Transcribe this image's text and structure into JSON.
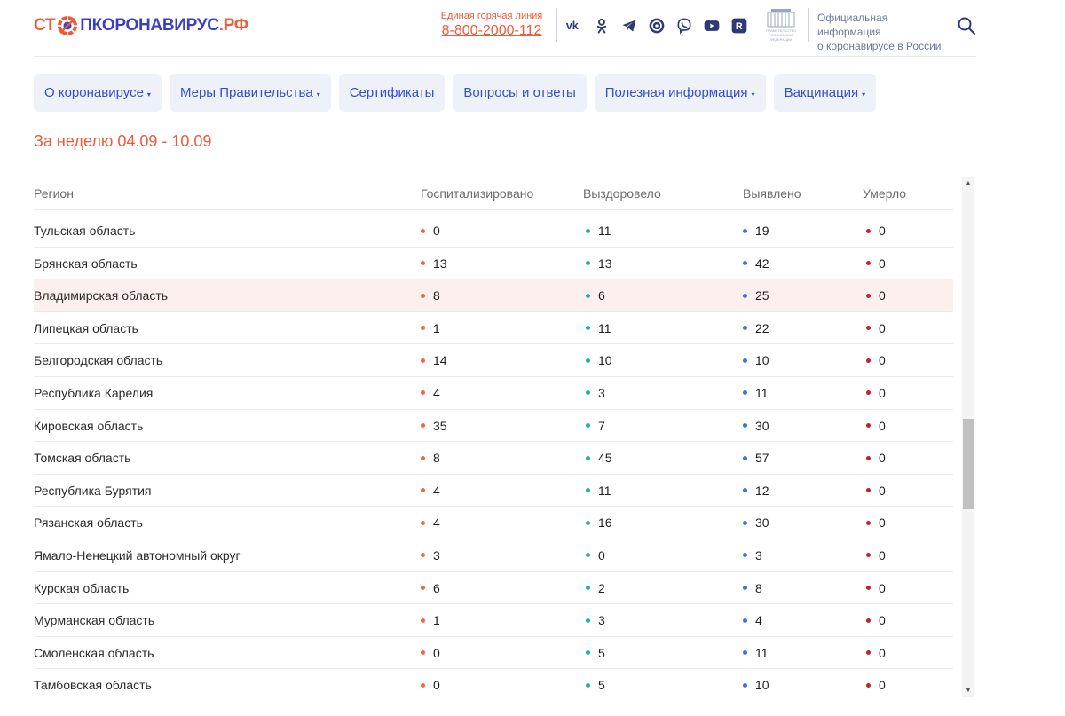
{
  "logo": {
    "part1": "СТ",
    "part2": "ПКОРОНАВИРУС",
    "part3": ".РФ"
  },
  "hotline": {
    "label": "Единая горячая линия",
    "phone": "8-800-2000-112"
  },
  "socials": [
    "vk-icon",
    "ok-icon",
    "telegram-icon",
    "tiktok-icon",
    "viber-icon",
    "youtube-icon",
    "rutube-icon"
  ],
  "gov": {
    "emblem_text": "ПРАВИТЕЛЬСТВО РОССИЙСКОЙ ФЕДЕРАЦИИ",
    "line1": "Официальная информация",
    "line2": "о коронавирусе в России"
  },
  "nav": [
    {
      "label": "О коронавирусе",
      "dropdown": "▾"
    },
    {
      "label": "Меры Правительства",
      "dropdown": "▾"
    },
    {
      "label": "Сертификаты",
      "dropdown": ""
    },
    {
      "label": "Вопросы и ответы",
      "dropdown": ""
    },
    {
      "label": "Полезная информация",
      "dropdown": "▾"
    },
    {
      "label": "Вакцинация",
      "dropdown": "▾"
    }
  ],
  "week_title": "За неделю 04.09 - 10.09",
  "table": {
    "headers": {
      "region": "Регион",
      "hospitalized": "Госпитализировано",
      "recovered": "Выздоровело",
      "detected": "Выявлено",
      "died": "Умерло"
    },
    "rows": [
      {
        "region": "Тульская область",
        "hospitalized": "0",
        "recovered": "11",
        "detected": "19",
        "died": "0"
      },
      {
        "region": "Брянская область",
        "hospitalized": "13",
        "recovered": "13",
        "detected": "42",
        "died": "0"
      },
      {
        "region": "Владимирская область",
        "hospitalized": "8",
        "recovered": "6",
        "detected": "25",
        "died": "0",
        "highlighted": true
      },
      {
        "region": "Липецкая область",
        "hospitalized": "1",
        "recovered": "11",
        "detected": "22",
        "died": "0"
      },
      {
        "region": "Белгородская область",
        "hospitalized": "14",
        "recovered": "10",
        "detected": "10",
        "died": "0"
      },
      {
        "region": "Республика Карелия",
        "hospitalized": "4",
        "recovered": "3",
        "detected": "11",
        "died": "0"
      },
      {
        "region": "Кировская область",
        "hospitalized": "35",
        "recovered": "7",
        "detected": "30",
        "died": "0"
      },
      {
        "region": "Томская область",
        "hospitalized": "8",
        "recovered": "45",
        "detected": "57",
        "died": "0"
      },
      {
        "region": "Республика Бурятия",
        "hospitalized": "4",
        "recovered": "11",
        "detected": "12",
        "died": "0"
      },
      {
        "region": "Рязанская область",
        "hospitalized": "4",
        "recovered": "16",
        "detected": "30",
        "died": "0"
      },
      {
        "region": "Ямало-Ненецкий автономный округ",
        "hospitalized": "3",
        "recovered": "0",
        "detected": "3",
        "died": "0"
      },
      {
        "region": "Курская область",
        "hospitalized": "6",
        "recovered": "2",
        "detected": "8",
        "died": "0"
      },
      {
        "region": "Мурманская область",
        "hospitalized": "1",
        "recovered": "3",
        "detected": "4",
        "died": "0"
      },
      {
        "region": "Смоленская область",
        "hospitalized": "0",
        "recovered": "5",
        "detected": "11",
        "died": "0"
      },
      {
        "region": "Тамбовская область",
        "hospitalized": "0",
        "recovered": "5",
        "detected": "10",
        "died": "0"
      }
    ]
  },
  "colors": {
    "accent": "#ee5a3a",
    "link": "#3350c9",
    "dot_hospitalized": "#ee6a3c",
    "dot_recovered": "#1fb59a",
    "dot_detected": "#3d6fe8",
    "dot_died": "#c8202b",
    "highlight_row": "#fcefee"
  },
  "icons": {
    "search": "search-icon",
    "scroll_up": "▲",
    "scroll_down": "▼"
  }
}
